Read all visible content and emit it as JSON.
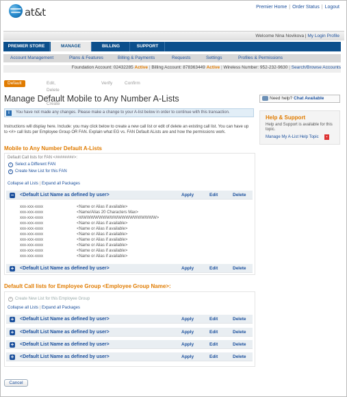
{
  "header": {
    "logo_text": "at&t",
    "links": [
      "Premier Home",
      "Order Status",
      "Logout"
    ],
    "welcome": "Welcome Nina Novikova",
    "profile_link": "My Login Profile"
  },
  "main_nav": [
    "PREMIER STORE",
    "MANAGE",
    "BILLING",
    "SUPPORT"
  ],
  "sub_nav": [
    "Account Management",
    "Plans & Features",
    "Billing & Payments",
    "Requests",
    "Settings",
    "Profiles & Permissions"
  ],
  "account_bar": {
    "foundation_label": "Foundation Account:",
    "foundation_number": "02432285",
    "billing_label": "Billing Account:",
    "billing_number": "878363449",
    "wireless_label": "Wireless Number:",
    "wireless_number": "952-232-9630",
    "status": "Active",
    "search_link": "Search/Browse Accounts"
  },
  "steps": [
    "Default A-List",
    "Edit, Delete or Create",
    "Verify",
    "Confirm"
  ],
  "page_title": "Manage Default Mobile to Any Number A-Lists",
  "notice": "You have not made any changes. Please make a change to your A-list below in order to continue with this transaction.",
  "instructions": "Instructions will display here. Include: you may click below to create a new call list or edit of delete an existing call list. You can have up to <#> call lists per Employee Group OR FAN. Explain what EG vs. FAN Default ALists are and how the permissions work.",
  "fan_section": {
    "title": "Mobile to Any Number Default A-Lists",
    "subtitle": "Default Call lists for FAN <########>:",
    "select_link": "Select a Different FAN",
    "create_link": "Create New List for this FAN",
    "collapse_all": "Collapse all Lists",
    "expand_all": "Expand all Packages",
    "expanded_list": {
      "name": "<Default List Name as defined by user>",
      "numbers": [
        "xxx-xxx-xxxx",
        "xxx-xxx-xxxx",
        "xxx-xxx-xxxx",
        "xxx-xxx-xxxx",
        "xxx-xxx-xxxx",
        "xxx-xxx-xxxx",
        "xxx-xxx-xxxx",
        "xxx-xxx-xxxx",
        "xxx-xxx-xxxx",
        "xxx-xxx-xxxx"
      ],
      "aliases": [
        "<Name or Alias if available>",
        "<Name/Alias 20 Characters Max>",
        "<WWWWWWWWWWWWWWWWWWWW>",
        "<Name or Alias if available>",
        "<Name or Alias if available>",
        "<Name or Alias if available>",
        "<Name or Alias if available>",
        "<Name or Alias if available>",
        "<Name or Alias if available>",
        "<Name or Alias if available>"
      ]
    },
    "collapsed_list_name": "<Default List Name as defined by user>"
  },
  "eg_section": {
    "title": "Default Call lists for Employee Group <Employee Group Name>:",
    "create_link": "Create New List for this Employee Group",
    "collapse_all": "Collapse all Lists",
    "expand_all": "Expand all Packages",
    "lists": [
      "<Default List Name as defined by user>",
      "<Default List Name as defined by user>",
      "<Default List Name as defined by user>",
      "<Default List Name as defined by user>"
    ]
  },
  "actions": {
    "apply": "Apply",
    "edit": "Edit",
    "delete": "Delete"
  },
  "cancel_label": "Cancel",
  "sidebar": {
    "help_prefix": "Need help?",
    "help_chat": "Chat Available",
    "help_title": "Help & Support",
    "help_text": "Help and Support is available for this topic.",
    "help_link": "Manage My A-List Help Topic"
  },
  "colors": {
    "brand_blue": "#0b4f8c",
    "accent_orange": "#e07b00",
    "link_blue": "#1a4f9c"
  }
}
